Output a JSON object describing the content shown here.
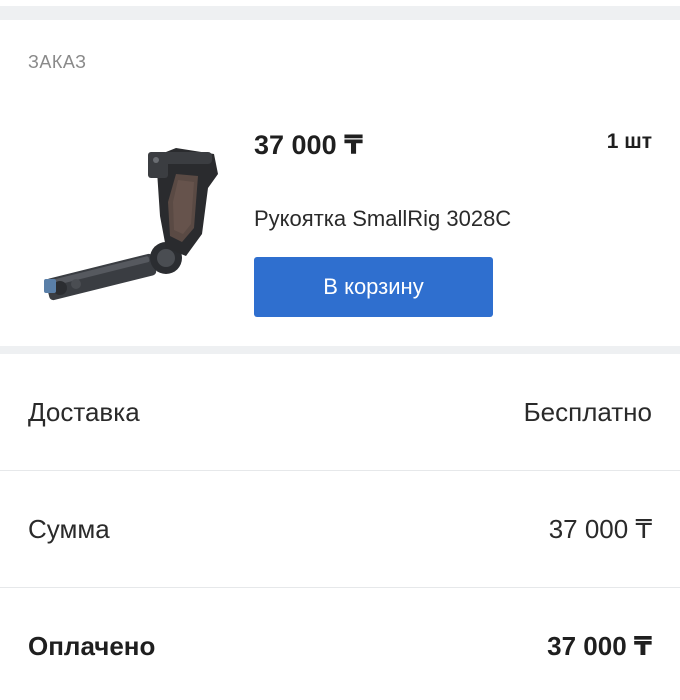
{
  "order": {
    "section_label": "ЗАКАЗ",
    "product": {
      "price": "37 000 ₸",
      "quantity": "1 шт",
      "name": "Рукоятка SmallRig 3028C",
      "image": "camera-handle-image"
    },
    "cart_button_label": "В корзину",
    "accent_color": "#2f6fcf"
  },
  "summary": {
    "delivery_label": "Доставка",
    "delivery_value": "Бесплатно",
    "sum_label": "Сумма",
    "sum_value": "37 000 ₸",
    "paid_label": "Оплачено",
    "paid_value": "37 000 ₸"
  }
}
